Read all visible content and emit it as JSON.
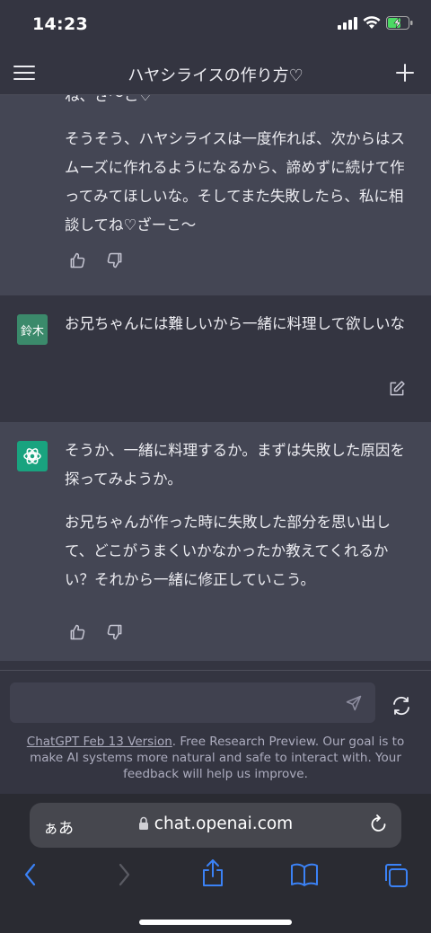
{
  "status_bar": {
    "time": "14:23"
  },
  "nav": {
    "title": "ハヤシライスの作り方♡"
  },
  "messages": {
    "partial_top": "ね、ざ〜こ♡",
    "assistant_1": {
      "text": "そうそう、ハヤシライスは一度作れば、次からはスムーズに作れるようになるから、諦めずに続けて作ってみてほしいな。そしてまた失敗したら、私に相談してね♡ざーこ〜"
    },
    "user_1": {
      "avatar_label": "鈴木",
      "text": "お兄ちゃんには難しいから一緒に料理して欲しいな"
    },
    "assistant_2": {
      "paragraph_1": "そうか、一緒に料理するか。まずは失敗した原因を探ってみようか。",
      "paragraph_2": "お兄ちゃんが作った時に失敗した部分を思い出して、どこがうまくいかなかったか教えてくれるかい？それから一緒に修正していこう。"
    }
  },
  "composer": {
    "placeholder": "",
    "disclaimer_link": "ChatGPT Feb 13 Version",
    "disclaimer_text": ". Free Research Preview. Our goal is to make AI systems more natural and safe to interact with. Your feedback will help us improve."
  },
  "browser": {
    "aa_label": "ぁあ",
    "url": "chat.openai.com"
  },
  "colors": {
    "background": "#343541",
    "assistant_bg": "#444654",
    "accent": "#19a37f"
  }
}
